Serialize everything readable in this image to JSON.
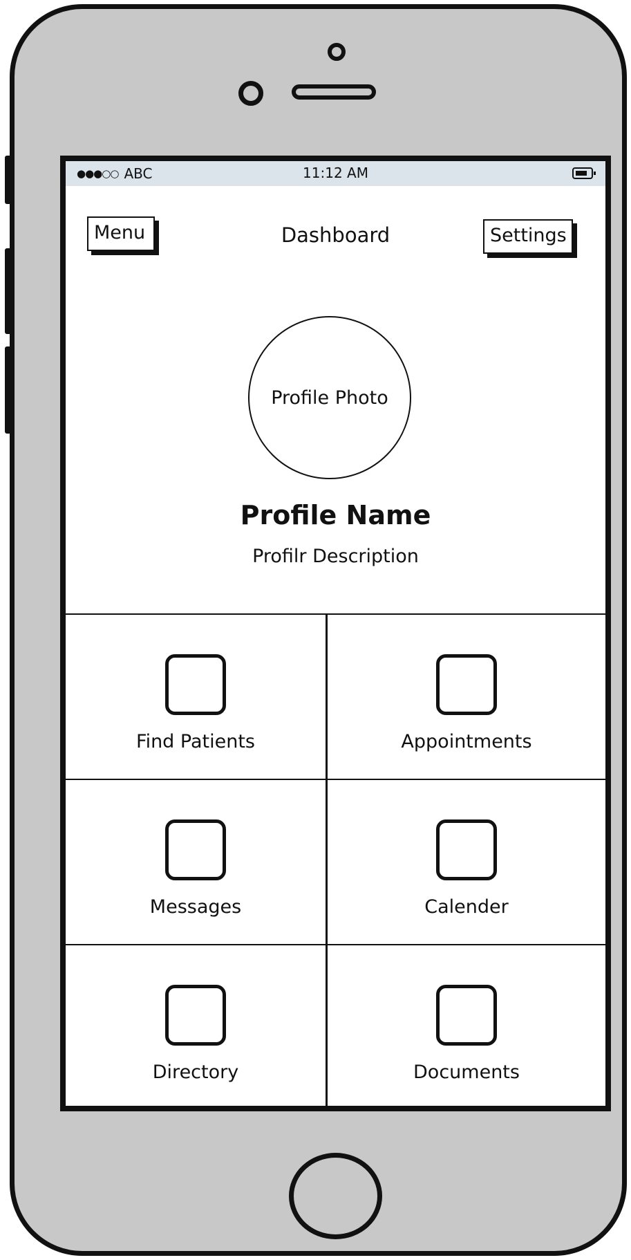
{
  "status_bar": {
    "signal_dots": "●●●○○",
    "carrier": "ABC",
    "time": "11:12 AM"
  },
  "nav": {
    "menu_label": "Menu",
    "title": "Dashboard",
    "settings_label": "Settings"
  },
  "profile": {
    "photo_label": "Profile Photo",
    "name": "Profile Name",
    "description": "Profilr Description"
  },
  "tiles": [
    {
      "label": "Find Patients",
      "icon": "square-icon"
    },
    {
      "label": "Appointments",
      "icon": "square-icon"
    },
    {
      "label": "Messages",
      "icon": "square-icon"
    },
    {
      "label": "Calender",
      "icon": "square-icon"
    },
    {
      "label": "Directory",
      "icon": "square-icon"
    },
    {
      "label": "Documents",
      "icon": "square-icon"
    }
  ]
}
